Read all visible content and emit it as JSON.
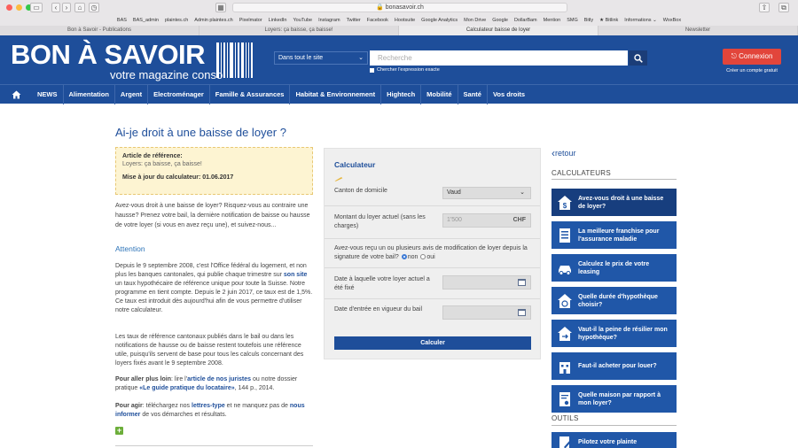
{
  "browser": {
    "url": "bonasavoir.ch",
    "bookmarks": [
      "BAS",
      "BAS_admin",
      "plaintes.ch",
      "Admin plaintes.ch",
      "Pixelmator",
      "LinkedIn",
      "YouTube",
      "Instagram",
      "Twitter",
      "Facebook",
      "Hootsuite",
      "Google Analytics",
      "Mon Drive",
      "Google",
      "DollarBam",
      "Mention",
      "SMG",
      "Bitly",
      "★ Bitlink",
      "Informations ⌄",
      "WoxBox"
    ],
    "tabs": [
      {
        "label": "Bon à Savoir - Publications",
        "active": false
      },
      {
        "label": "Loyers: ça baisse, ça baisse!",
        "active": false
      },
      {
        "label": "Calculateur baisse de loyer",
        "active": true
      },
      {
        "label": "Newsletter",
        "active": false
      }
    ]
  },
  "header": {
    "logo_title": "BON À SAVOIR",
    "logo_subtitle": "votre magazine conso",
    "search_scope": "Dans tout le site",
    "search_placeholder": "Recherche",
    "exact_label": "Chercher l'expression exacte",
    "login_label": "Connexion",
    "create_account": "Créer un compte gratuit",
    "accent": "#1e4e9a",
    "login_color": "#e2453b"
  },
  "nav": {
    "items": [
      "NEWS",
      "Alimentation",
      "Argent",
      "Electroménager",
      "Famille & Assurances",
      "Habitat & Environnement",
      "Hightech",
      "Mobilité",
      "Santé",
      "Vos droits"
    ]
  },
  "article": {
    "title": "Ai-je droit à une baisse de loyer ?",
    "ref_label": "Article de référence:",
    "ref_value": "Loyers: ça baisse, ça baisse!",
    "update_label": "Mise à jour du calculateur: 01.06.2017",
    "intro": "Avez-vous droit à une baisse de loyer? Risquez-vous au contraire une hausse? Prenez votre bail, la dernière notification de baisse ou hausse de votre loyer (si vous en avez reçu une), et suivez-nous...",
    "attention_heading": "Attention",
    "p1_a": "Depuis le 9 septembre 2008, c'est l'Office fédéral du logement, et non plus les banques cantonales, qui publie chaque trimestre sur ",
    "p1_link": "son site",
    "p1_b": " un taux hypothécaire de référence unique pour toute la Suisse. Notre programme en tient compte. Depuis le 2 juin 2017, ce taux est de 1,5%. Ce taux est introduit dès aujourd'hui afin de vous permettre d'utiliser notre calculateur.",
    "p2": "Les taux de référence cantonaux publiés dans le bail ou dans les notifications de hausse ou de baisse restent toutefois une référence utile, puisqu'ils servent de base pour tous les calculs concernant des loyers fixés avant le 9 septembre 2008.",
    "p3_bold": "Pour aller plus loin",
    "p3_a": ": lire l'",
    "p3_link1": "article de nos juristes",
    "p3_b": " ou notre dossier pratique ",
    "p3_link2": "«Le guide pratique du locataire»",
    "p3_c": ", 144 p., 2014.",
    "p4_bold": "Pour agir",
    "p4_a": ": téléchargez nos ",
    "p4_link1": "lettres-type",
    "p4_b": " et ne manquez pas de ",
    "p4_link2": "nous informer",
    "p4_c": " de vos démarches et résultats."
  },
  "calculator": {
    "title": "Calculateur",
    "canton_label": "Canton de domicile",
    "canton_value": "Vaud",
    "rent_label": "Montant du loyer actuel (sans les charges)",
    "rent_placeholder": "1'500",
    "rent_unit": "CHF",
    "notice_question": "Avez-vous reçu un ou plusieurs avis de modification de loyer depuis la signature de votre bail?",
    "option_no": "non",
    "option_yes": "oui",
    "date_fixed_label": "Date à laquelle votre loyer actuel a été fixé",
    "date_start_label": "Date d'entrée en vigueur du bail",
    "submit_label": "Calculer"
  },
  "sidebar": {
    "back_label": "retour",
    "calculators_heading": "CALCULATEURS",
    "calculators": [
      {
        "label": "Avez-vous droit à une baisse de loyer?",
        "icon": "house-dollar-icon",
        "active": true
      },
      {
        "label": "La meilleure franchise pour l'assurance maladie",
        "icon": "document-list-icon",
        "active": false
      },
      {
        "label": "Calculez le prix de votre leasing",
        "icon": "car-icon",
        "active": false
      },
      {
        "label": "Quelle durée d'hypothèque choisir?",
        "icon": "house-clock-icon",
        "active": false
      },
      {
        "label": "Vaut-il la peine de résilier mon hypothèque?",
        "icon": "house-arrow-icon",
        "active": false
      },
      {
        "label": "Faut-il acheter pour louer?",
        "icon": "building-icon",
        "active": false
      },
      {
        "label": "Quelle maison par rapport à mon loyer?",
        "icon": "contract-icon",
        "active": false
      }
    ],
    "tools_heading": "OUTILS",
    "tools": [
      {
        "label": "Pilotez votre plainte",
        "icon": "doc-pen-icon"
      }
    ]
  }
}
